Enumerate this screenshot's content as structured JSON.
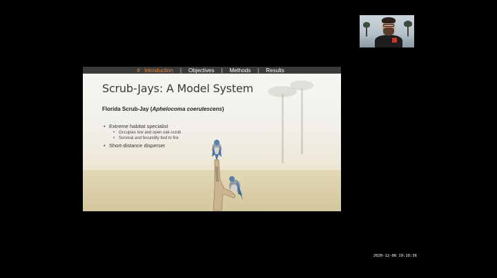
{
  "nav": {
    "items": [
      {
        "label": "Introduction",
        "active": true
      },
      {
        "label": "Objectives",
        "active": false
      },
      {
        "label": "Methods",
        "active": false
      },
      {
        "label": "Results",
        "active": false
      }
    ],
    "separator": "|",
    "active_color": "#e8873a"
  },
  "slide": {
    "title": "Scrub-Jays: A Model System",
    "subtitle_prefix": "Florida Scrub-Jay (",
    "subtitle_scientific": "Aphelocoma coerulescens",
    "subtitle_suffix": ")",
    "bullets": [
      {
        "text": "Extreme habitat specialist",
        "sub": [
          "Occupies low and open oak-scrub",
          "Survival and fecundity tied to fire"
        ]
      },
      {
        "text": "Short-distance disperser",
        "sub": []
      }
    ]
  },
  "overlay": {
    "timestamp": "2020-12-08  19:10:36"
  },
  "icons": {
    "nav_logo": "sprout-icon"
  }
}
